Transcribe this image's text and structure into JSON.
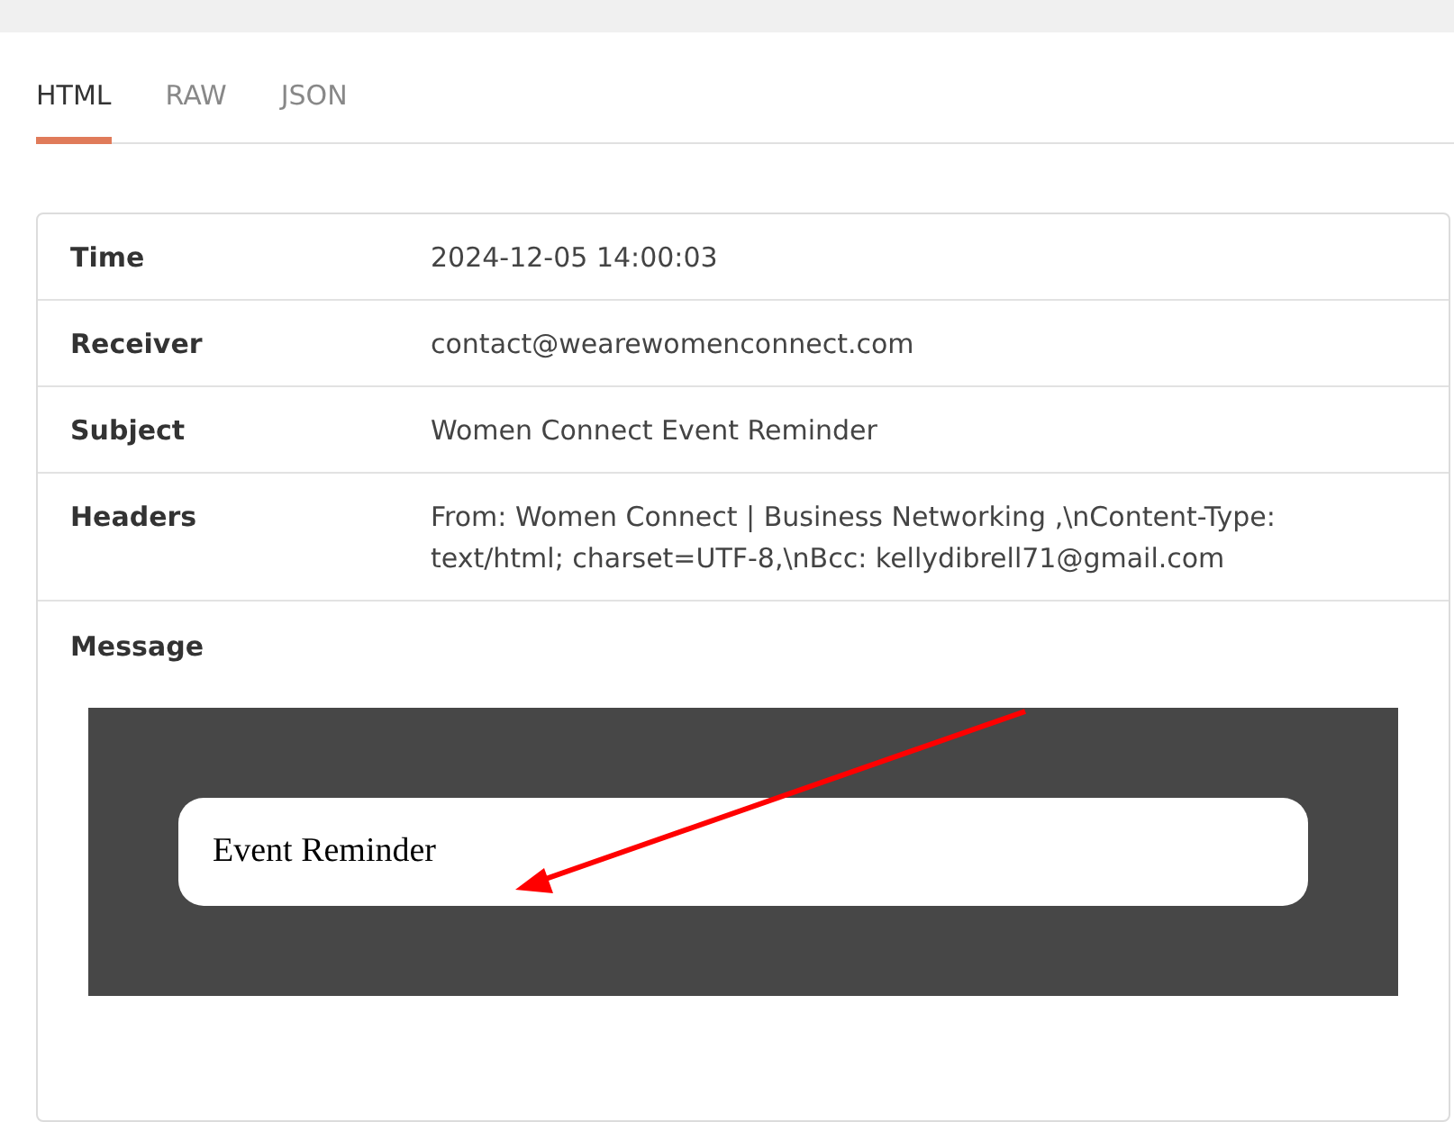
{
  "tabs": [
    {
      "label": "HTML",
      "selected": true
    },
    {
      "label": "RAW",
      "selected": false
    },
    {
      "label": "JSON",
      "selected": false
    }
  ],
  "details": [
    {
      "label": "Time",
      "value": "2024-12-05 14:00:03"
    },
    {
      "label": "Receiver",
      "value": "contact@wearewomenconnect.com"
    },
    {
      "label": "Subject",
      "value": "Women Connect Event Reminder"
    },
    {
      "label": "Headers",
      "value": "From: Women Connect | Business Networking ,\\nContent-Type: text/html; charset=UTF-8,\\nBcc: kellydibrell71@gmail.com"
    }
  ],
  "message": {
    "label": "Message",
    "preview_heading": "Event Reminder"
  }
}
